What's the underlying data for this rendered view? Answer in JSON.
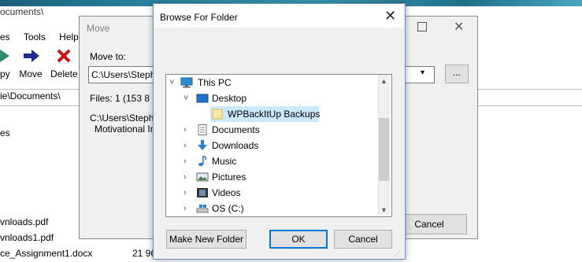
{
  "app": {
    "title": "ocuments\\",
    "menu": [
      "es",
      "Tools",
      "Help"
    ],
    "toolbar": {
      "copy": "py",
      "move": "Move",
      "delete": "Delete"
    },
    "path": "ie\\Documents\\",
    "list": [
      "es",
      "vnloads.pdf",
      "vnloads1.pdf",
      "ce_Assignment1.docx"
    ],
    "list_size": "21 96"
  },
  "move_dialog": {
    "title": "Move",
    "move_to_label": "Move to:",
    "combo_value": "C:\\Users\\Stepha",
    "browse_label": "...",
    "files": "Files: 1   (153 8",
    "source_line1": "C:\\Users\\Stepha",
    "source_line2": "Motivational Ima",
    "cancel_label": "Cancel"
  },
  "browse_dialog": {
    "title": "Browse For Folder",
    "tree": [
      {
        "label": "This PC",
        "chevron": "˅",
        "icon": "computer-icon"
      },
      {
        "label": "Desktop",
        "chevron": "˅",
        "icon": "desktop-icon"
      },
      {
        "label": "WPBackItUp Backups",
        "chevron": "",
        "icon": "folder-icon",
        "selected": true
      },
      {
        "label": "Documents",
        "chevron": "›",
        "icon": "documents-icon"
      },
      {
        "label": "Downloads",
        "chevron": "›",
        "icon": "downloads-icon"
      },
      {
        "label": "Music",
        "chevron": "›",
        "icon": "music-icon"
      },
      {
        "label": "Pictures",
        "chevron": "›",
        "icon": "pictures-icon"
      },
      {
        "label": "Videos",
        "chevron": "›",
        "icon": "videos-icon"
      },
      {
        "label": "OS (C:)",
        "chevron": "›",
        "icon": "drive-icon"
      }
    ],
    "buttons": {
      "new_folder": "Make New Folder",
      "ok": "OK",
      "cancel": "Cancel"
    }
  },
  "colors": {
    "selection": "#cce8ff",
    "accent": "#0078d7",
    "move_arrow": "#1f2a8c",
    "delete_x": "#d01010",
    "copy_icon": "#2e8b6f"
  }
}
